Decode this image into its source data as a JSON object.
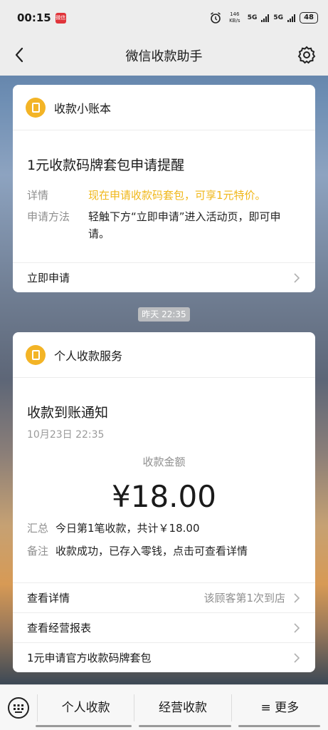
{
  "status": {
    "time": "00:15",
    "badge": "微信",
    "net_speed": "146 KB/s",
    "sim1": "5G",
    "sim2": "5G",
    "battery": "48"
  },
  "nav": {
    "title": "微信收款助手"
  },
  "card1": {
    "header": "收款小账本",
    "title": "1元收款码牌套包申请提醒",
    "rows": [
      {
        "k": "详情",
        "v": "现在申请收款码套包，可享1元特价。"
      },
      {
        "k": "申请方法",
        "v": "轻触下方“立即申请”进入活动页，即可申请。"
      }
    ],
    "link": "立即申请"
  },
  "time_pill": "昨天 22:35",
  "card2": {
    "header": "个人收款服务",
    "title": "收款到账通知",
    "date": "10月23日 22:35",
    "amount_label": "收款金额",
    "amount": "¥18.00",
    "rows": [
      {
        "k": "汇总",
        "v": "今日第1笔收款，共计￥18.00"
      },
      {
        "k": "备注",
        "v": "收款成功，已存入零钱，点击可查看详情"
      }
    ],
    "links": [
      {
        "label": "查看详情",
        "right": "该顾客第1次到店"
      },
      {
        "label": "查看经营报表",
        "right": ""
      },
      {
        "label": "1元申请官方收款码牌套包",
        "right": ""
      }
    ]
  },
  "bottom_menu": [
    "个人收款",
    "经营收款",
    "≡ 更多"
  ]
}
